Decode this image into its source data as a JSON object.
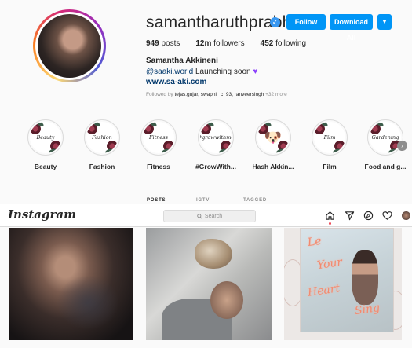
{
  "profile": {
    "username": "samantharuthprabhu...",
    "buttons": {
      "follow": "Follow",
      "download": "Download All",
      "more": "▾"
    },
    "stats": {
      "posts": "949",
      "posts_label": "posts",
      "followers": "12m",
      "followers_label": "followers",
      "following": "452",
      "following_label": "following"
    },
    "full_name": "Samantha Akkineni",
    "bio_handle": "@saaki.world",
    "bio_text": " Launching soon ",
    "website": "www.sa-aki.com",
    "followed_by_prefix": "Followed by ",
    "followed_by_names": "tejas.gujar, swapnil_c_93, ranveersingh",
    "followed_by_more": " +32 more"
  },
  "highlights": [
    {
      "label": "Beauty",
      "script": "Beauty"
    },
    {
      "label": "Fashion",
      "script": "Fashion"
    },
    {
      "label": "Fitness",
      "script": "Fitness"
    },
    {
      "label": "#GrowWith...",
      "script": "#growwithme"
    },
    {
      "label": "Hash Akkin...",
      "script": ""
    },
    {
      "label": "Film",
      "script": "Film"
    },
    {
      "label": "Food and g...",
      "script": "Gardening"
    }
  ],
  "tabs": [
    {
      "label": "POSTS"
    },
    {
      "label": "IGTV"
    },
    {
      "label": "TAGGED"
    }
  ],
  "nav": {
    "logo": "Instagram",
    "search_placeholder": "Search"
  },
  "post_text": {
    "neon1": "Le",
    "neon2": "Your",
    "neon3": "Heart",
    "neon4": "Sing"
  },
  "colors": {
    "accent": "#0095f6",
    "verified": "#3897f0",
    "link": "#00376b",
    "notification": "#ed4956"
  }
}
